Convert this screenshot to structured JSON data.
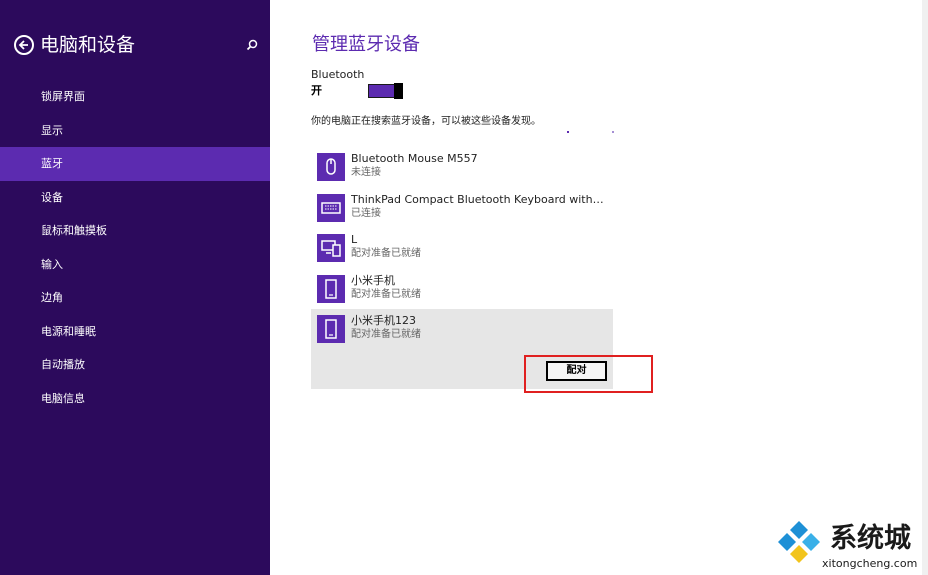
{
  "colors": {
    "sidebar_bg": "#2c0a5c",
    "accent": "#5c2bb0",
    "selected_bg": "#e6e6e6",
    "highlight_red": "#e02020"
  },
  "sidebar": {
    "title": "电脑和设备",
    "back_icon": "back-arrow-icon",
    "search_icon": "search-icon",
    "items": [
      {
        "label": "锁屏界面"
      },
      {
        "label": "显示"
      },
      {
        "label": "蓝牙",
        "active": true
      },
      {
        "label": "设备"
      },
      {
        "label": "鼠标和触摸板"
      },
      {
        "label": "输入"
      },
      {
        "label": "边角"
      },
      {
        "label": "电源和睡眠"
      },
      {
        "label": "自动播放"
      },
      {
        "label": "电脑信息"
      }
    ]
  },
  "main": {
    "title": "管理蓝牙设备",
    "bluetooth_label": "Bluetooth",
    "bluetooth_state": "开",
    "bluetooth_on": true,
    "search_text": "你的电脑正在搜索蓝牙设备，可以被这些设备发现。",
    "devices": [
      {
        "name": "Bluetooth Mouse M557",
        "status": "未连接",
        "icon": "mouse-icon"
      },
      {
        "name": "ThinkPad Compact Bluetooth Keyboard with TrackPoint",
        "status": "已连接",
        "icon": "keyboard-icon"
      },
      {
        "name": "L",
        "status": "配对准备已就绪",
        "icon": "computer-phone-icon"
      },
      {
        "name": "小米手机",
        "status": "配对准备已就绪",
        "icon": "phone-icon"
      },
      {
        "name": "小米手机123",
        "status": "配对准备已就绪",
        "icon": "phone-icon",
        "selected": true
      }
    ],
    "pair_button": "配对"
  },
  "watermark": {
    "text": "系统城",
    "url": "xitongcheng.com",
    "logo_icon": "diamond-logo-icon"
  }
}
